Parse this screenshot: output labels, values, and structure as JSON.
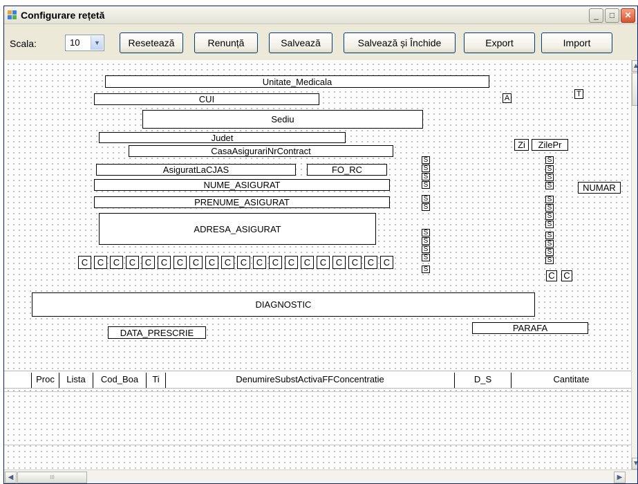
{
  "window": {
    "title": "Configurare rețetă",
    "controls": {
      "minimize": "_",
      "maximize": "□",
      "close": "✕"
    }
  },
  "toolbar": {
    "scale_label": "Scala:",
    "scale_value": "10",
    "reset_label": "Resetează",
    "cancel_label": "Renunță",
    "save_label": "Salvează",
    "save_close_label": "Salvează și Închide",
    "export_label": "Export",
    "import_label": "Import"
  },
  "fields": {
    "unitate": "Unitate_Medicala",
    "cui": "CUI",
    "sediu": "Sediu",
    "judet": "Judet",
    "casa": "CasaAsigurariNrContract",
    "asigurat_cjas": "AsiguratLaCJAS",
    "fo_rc": "FO_RC",
    "nume": "NUME_ASIGURAT",
    "prenume": "PRENUME_ASIGURAT",
    "adresa": "ADRESA_ASIGURAT",
    "diagnostic": "DIAGNOSTIC",
    "data_prescrie": "DATA_PRESCRIE",
    "parafa": "PARAFA",
    "a_box": "A",
    "t_box": "T",
    "zi": "Zi",
    "zile_pr": "ZilePr",
    "numar": "NUMAR"
  },
  "markers": {
    "s": "S",
    "c": "C"
  },
  "grid": {
    "columns": [
      "Proc",
      "Lista",
      "Cod_Boa",
      "Ti",
      "DenumireSubstActivaFFConcentratie",
      "D_S",
      "Cantitate"
    ]
  },
  "scroll": {
    "up": "▲",
    "down": "▼",
    "left": "◀",
    "right": "▶",
    "grip": "III"
  }
}
